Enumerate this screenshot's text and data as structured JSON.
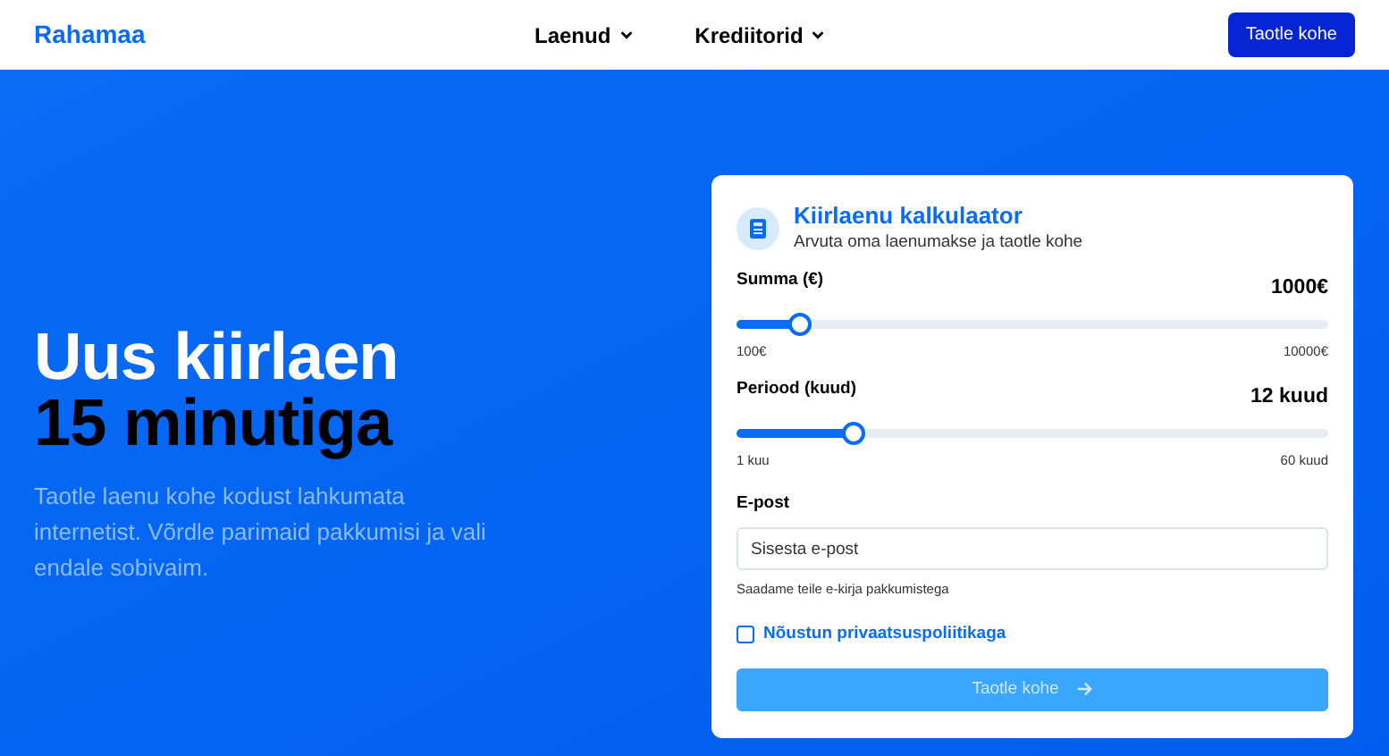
{
  "header": {
    "logo": "Rahamaa",
    "nav": [
      {
        "label": "Laenud"
      },
      {
        "label": "Krediitorid"
      }
    ],
    "cta": "Taotle kohe"
  },
  "hero": {
    "title_line_1": "Uus kiirlaen",
    "title_line_2": "15 minutiga",
    "text": "Taotle laenu kohe kodust lahkumata internetist. Võrdle parimaid pakkumisi ja vali endale sobivaim."
  },
  "calculator": {
    "title": "Kiirlaenu kalkulaator",
    "subtitle": "Arvuta oma laenumakse ja taotle kohe",
    "sliders": [
      {
        "label": "Summa (€)",
        "reading": "1000€",
        "level": 0.106,
        "min": "100€",
        "max": "10000€"
      },
      {
        "label": "Periood (kuud)",
        "reading": "12 kuud",
        "level": 0.197,
        "min": "1 kuu",
        "max": "60 kuud"
      }
    ],
    "email": {
      "label": "E-post",
      "placeholder": "Sisesta e-post",
      "hint": "Saadame teile e-kirja pakkumistega"
    },
    "consent": {
      "label": "Nõustun privaatsuspoliitikaga",
      "checked": false
    },
    "submit": "Taotle kohe",
    "submit_disabled": true
  }
}
